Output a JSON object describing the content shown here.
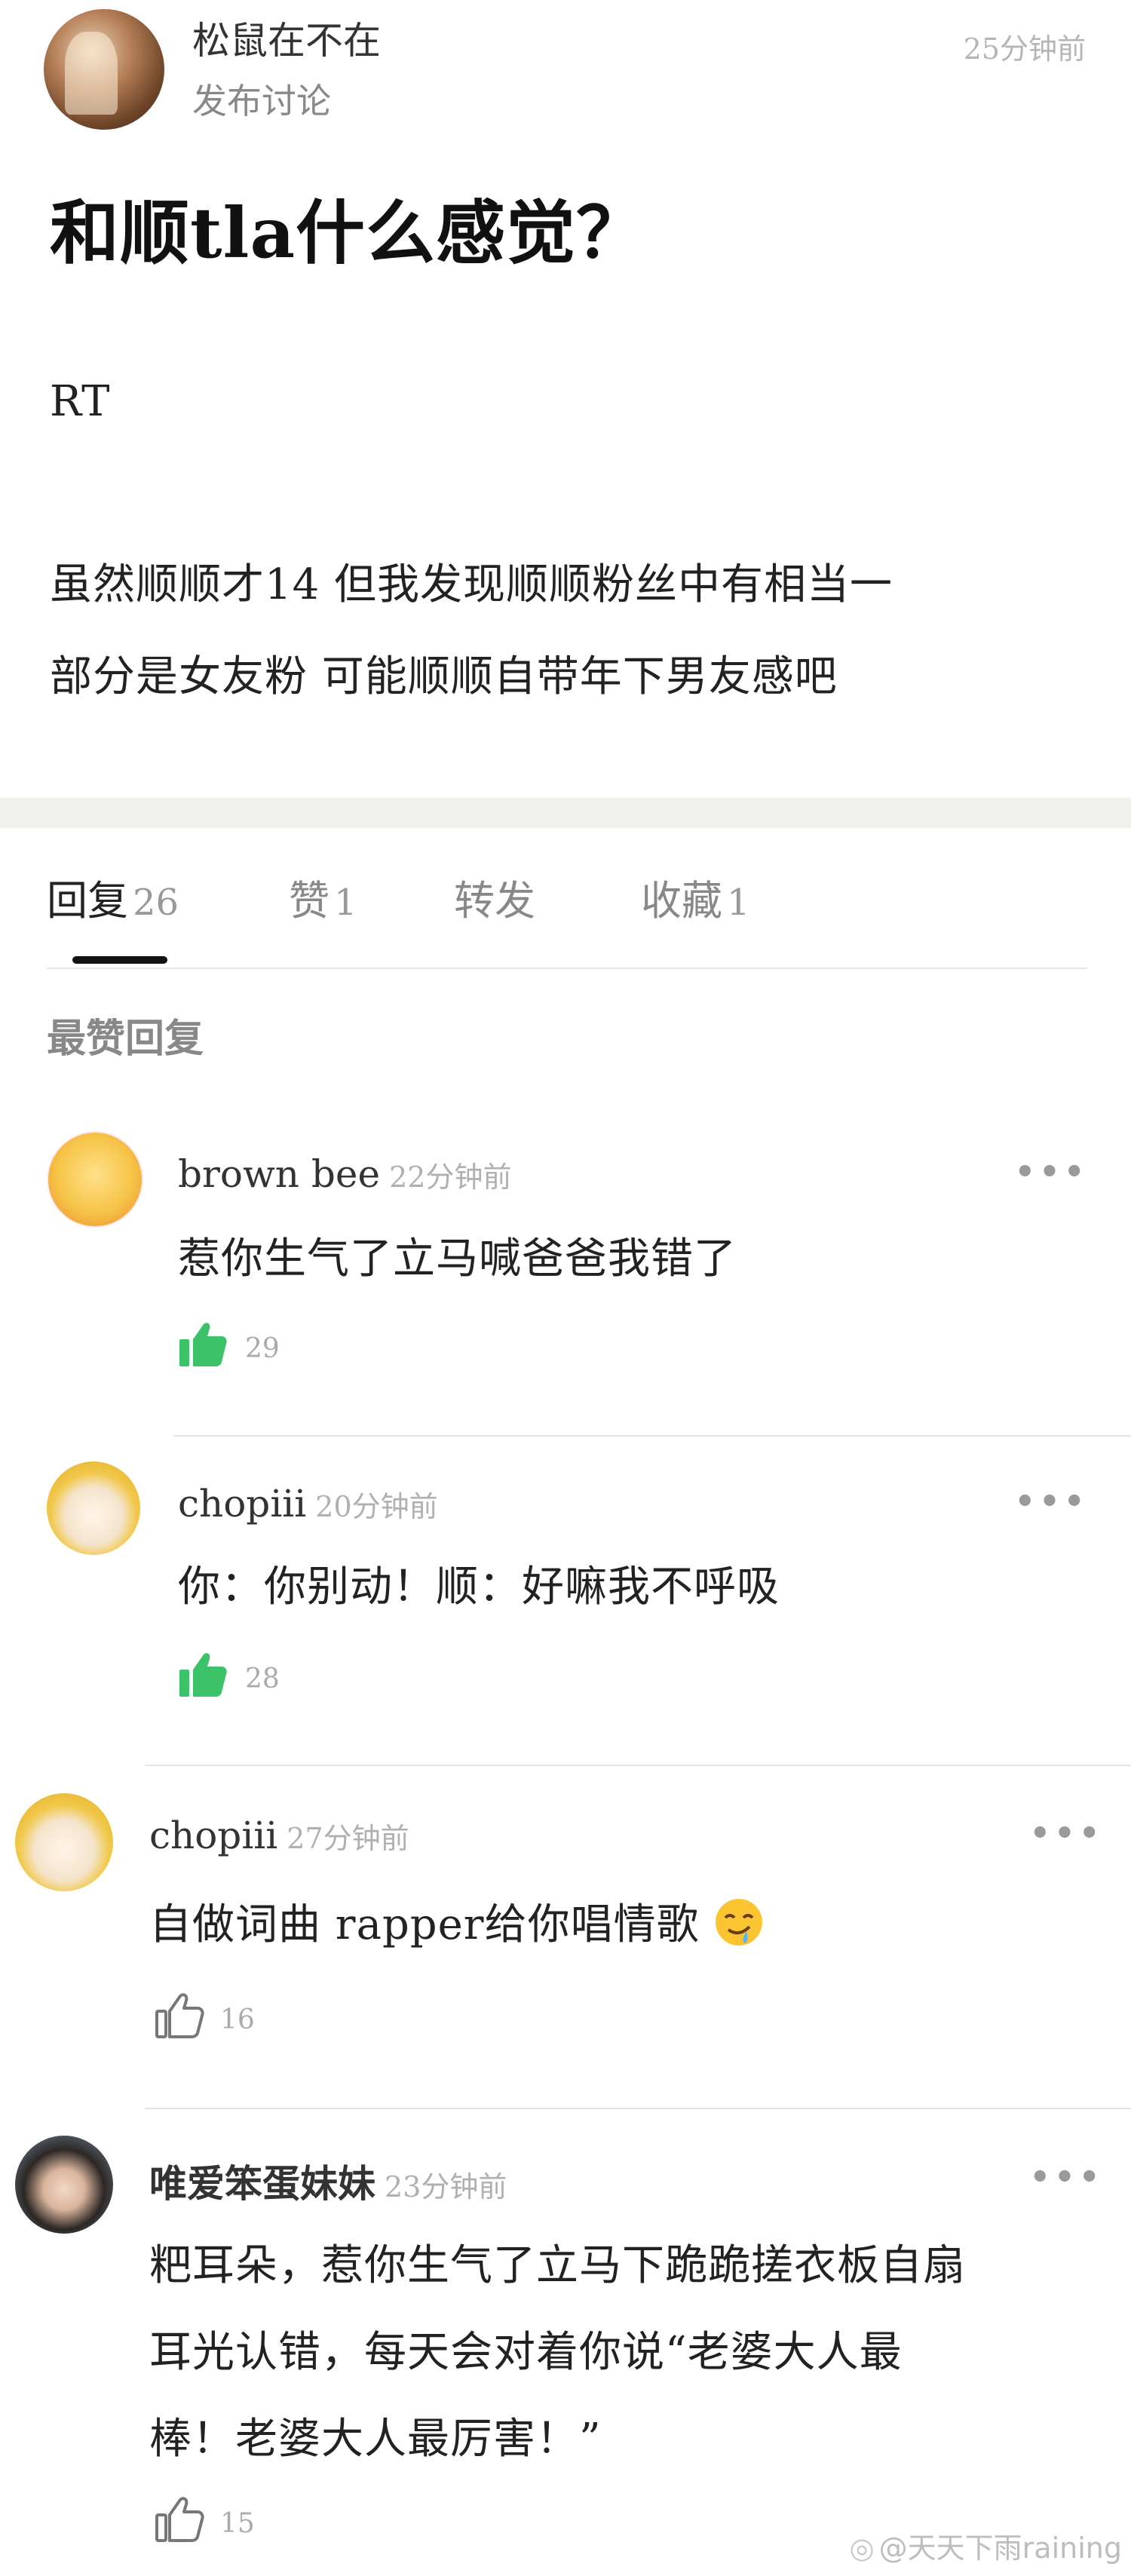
{
  "post": {
    "author": "松鼠在不在",
    "action": "发布讨论",
    "time": "25分钟前",
    "title": "和顺tla什么感觉？",
    "body_lines": [
      "RT",
      "虽然顺顺才14 但我发现顺顺粉丝中有相当一",
      "部分是女友粉 可能顺顺自带年下男友感吧"
    ]
  },
  "tabs": [
    {
      "label": "回复",
      "count": "26",
      "active": true
    },
    {
      "label": "赞",
      "count": "1",
      "active": false
    },
    {
      "label": "转发",
      "count": "",
      "active": false
    },
    {
      "label": "收藏",
      "count": "1",
      "active": false
    }
  ],
  "section_title": "最赞回复",
  "comments": [
    {
      "name": "brown bee",
      "time": "22分钟前",
      "text_lines": [
        "惹你生气了立马喊爸爸我错了"
      ],
      "likes": "29",
      "liked": true,
      "avatar_icon": "pleading-emoji-avatar"
    },
    {
      "name": "chopiii",
      "time": "20分钟前",
      "text_lines": [
        "你：你别动！顺：好嘛我不呼吸"
      ],
      "likes": "28",
      "liked": true,
      "avatar_icon": "chick-avatar"
    },
    {
      "name": "chopiii",
      "time": "27分钟前",
      "text_lines": [
        "自做词曲 rapper给你唱情歌"
      ],
      "emoji": "drooling-face-emoji",
      "likes": "16",
      "liked": false,
      "avatar_icon": "chick-avatar"
    },
    {
      "name": "唯爱笨蛋妹妹",
      "time": "23分钟前",
      "text_lines": [
        "粑耳朵，惹你生气了立马下跪跪搓衣板自扇",
        "耳光认错，每天会对着你说“老婆大人最",
        "棒！老婆大人最厉害！”"
      ],
      "likes": "15",
      "liked": false,
      "avatar_icon": "person-avatar"
    }
  ],
  "more_label": "•••",
  "watermark": "@天天下雨raining",
  "colors": {
    "liked_thumb": "#3cc36a",
    "muted": "#9a9a9a",
    "divider": "#efefec"
  }
}
